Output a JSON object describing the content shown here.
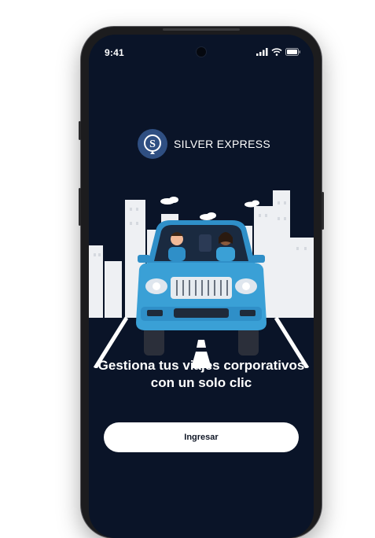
{
  "status_bar": {
    "time": "9:41",
    "icons": [
      "signal-icon",
      "wifi-icon",
      "battery-icon"
    ]
  },
  "brand": {
    "name": "SILVER EXPRESS",
    "logo_letter": "S"
  },
  "illustration": {
    "subject": "car-with-driver-and-passenger"
  },
  "headline": "Gestiona tus viajes corporativos con un solo clic",
  "login_button": {
    "label": "Ingresar"
  },
  "colors": {
    "background": "#0a1428",
    "accent": "#3aa0d6",
    "logo_circle": "#2f4f82",
    "button": "#ffffff"
  }
}
